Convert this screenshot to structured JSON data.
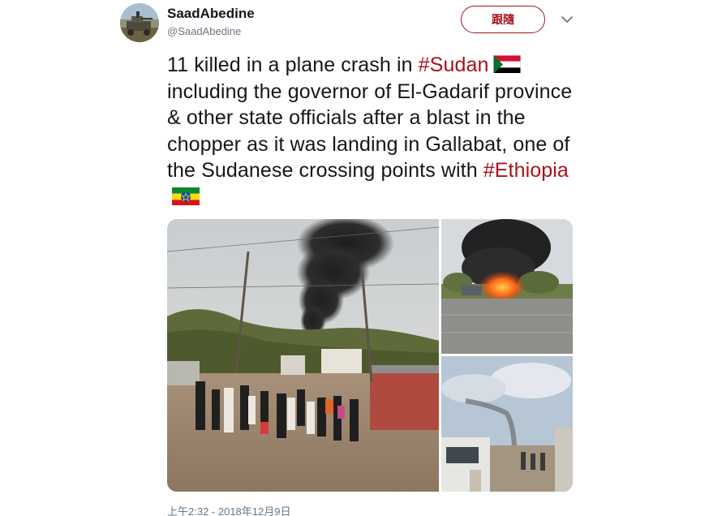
{
  "user": {
    "display_name": "SaadAbedine",
    "handle": "@SaadAbedine"
  },
  "follow_button_label": "跟隨",
  "menu_icon": "chevron-down-icon",
  "tweet": {
    "text_part1": "11 killed in a plane crash in ",
    "hashtag1": "#Sudan",
    "text_part2": "including the governor of El-Gadarif province & other state officials after a blast in the chopper as it was landing in Gallabat, one of the Sudanese crossing points with ",
    "hashtag2": "#Ethiopia",
    "emoji1": "sudan-flag-icon",
    "emoji2": "ethiopia-flag-icon"
  },
  "media": [
    {
      "id": "photo-crowd-smoke"
    },
    {
      "id": "photo-burning-wreck"
    },
    {
      "id": "photo-distant-smoke"
    }
  ],
  "timestamp": "上午2:32 - 2018年12月9日",
  "colors": {
    "accent": "#a5141b",
    "text": "#14171a",
    "secondary": "#657786"
  }
}
